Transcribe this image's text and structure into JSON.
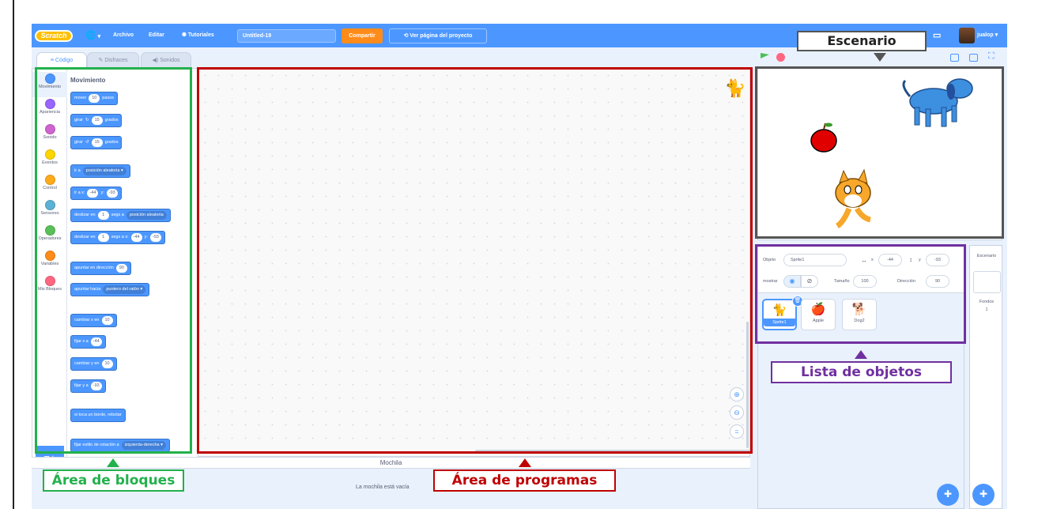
{
  "menubar": {
    "logo": "Scratch",
    "globe_icon": "globe-icon",
    "archivo": "Archivo",
    "editar": "Editar",
    "tutoriales": "Tutoriales",
    "project_title": "Untitled-19",
    "share": "Compartir",
    "project_page": "Ver página del proyecto",
    "user": "jualop"
  },
  "tabs": {
    "code": "Código",
    "costumes": "Disfraces",
    "sounds": "Sonidos"
  },
  "categories": [
    {
      "label": "Movimiento",
      "color": "#4c97ff"
    },
    {
      "label": "Apariencia",
      "color": "#9966ff"
    },
    {
      "label": "Sonido",
      "color": "#cf63cf"
    },
    {
      "label": "Eventos",
      "color": "#ffd500"
    },
    {
      "label": "Control",
      "color": "#ffab19"
    },
    {
      "label": "Sensores",
      "color": "#5cb1d6"
    },
    {
      "label": "Operadores",
      "color": "#59c059"
    },
    {
      "label": "Variables",
      "color": "#ff8c1a"
    },
    {
      "label": "Mis Bloques",
      "color": "#ff6680"
    }
  ],
  "palette": {
    "title": "Movimiento",
    "move": {
      "a": "mover",
      "v": "10",
      "b": "pasos"
    },
    "turn_r": {
      "a": "girar",
      "v": "15",
      "b": "grados"
    },
    "turn_l": {
      "a": "girar",
      "v": "15",
      "b": "grados"
    },
    "goto": {
      "a": "ir a",
      "d": "posición aleatoria ▾"
    },
    "goto_xy": {
      "a": "ir a x:",
      "x": "-44",
      "b": "y:",
      "y": "-93"
    },
    "glide": {
      "a": "deslizar en",
      "v": "1",
      "b": "segs a",
      "d": "posición aleatoria"
    },
    "glide_xy": {
      "a": "deslizar en",
      "v": "1",
      "b": "segs a x:",
      "x": "-44",
      "c": "y:",
      "y": "-93"
    },
    "point_dir": {
      "a": "apuntar en dirección",
      "v": "90"
    },
    "point_to": {
      "a": "apuntar hacia",
      "d": "puntero del ratón ▾"
    },
    "change_x": {
      "a": "cambiar x en",
      "v": "10"
    },
    "set_x": {
      "a": "fijar x a",
      "v": "-44"
    },
    "change_y": {
      "a": "cambiar y en",
      "v": "10"
    },
    "set_y": {
      "a": "fijar y a",
      "v": "-93"
    },
    "bounce": {
      "a": "si toca un borde, rebotar"
    },
    "rot_style": {
      "a": "fijar estilo de rotación a",
      "d": "izquierda-derecha ▾"
    }
  },
  "backpack": {
    "label": "Mochila",
    "empty": "La mochila está vacía"
  },
  "sprite_info": {
    "objeto_label": "Objeto",
    "name": "Sprite1",
    "x_label": "x",
    "x": "-44",
    "y_label": "y",
    "y": "-93",
    "mostrar_label": "mostrar",
    "size_label": "Tamaño",
    "size": "100",
    "dir_label": "Dirección",
    "dir": "90"
  },
  "sprites": [
    {
      "name": "Sprite1"
    },
    {
      "name": "Apple"
    },
    {
      "name": "Dog2"
    }
  ],
  "stage_panel": {
    "label": "Escenario",
    "fondos": "Fondos",
    "count": "1"
  },
  "annotations": {
    "escenario": "Escenario",
    "lista": "Lista de objetos",
    "bloques": "Área de bloques",
    "programas": "Área de programas"
  },
  "colors": {
    "accent": "#4c97ff",
    "share": "#ff8c1a",
    "green_box": "#22b14c",
    "red_box": "#c00000",
    "purple_box": "#7030a0"
  }
}
